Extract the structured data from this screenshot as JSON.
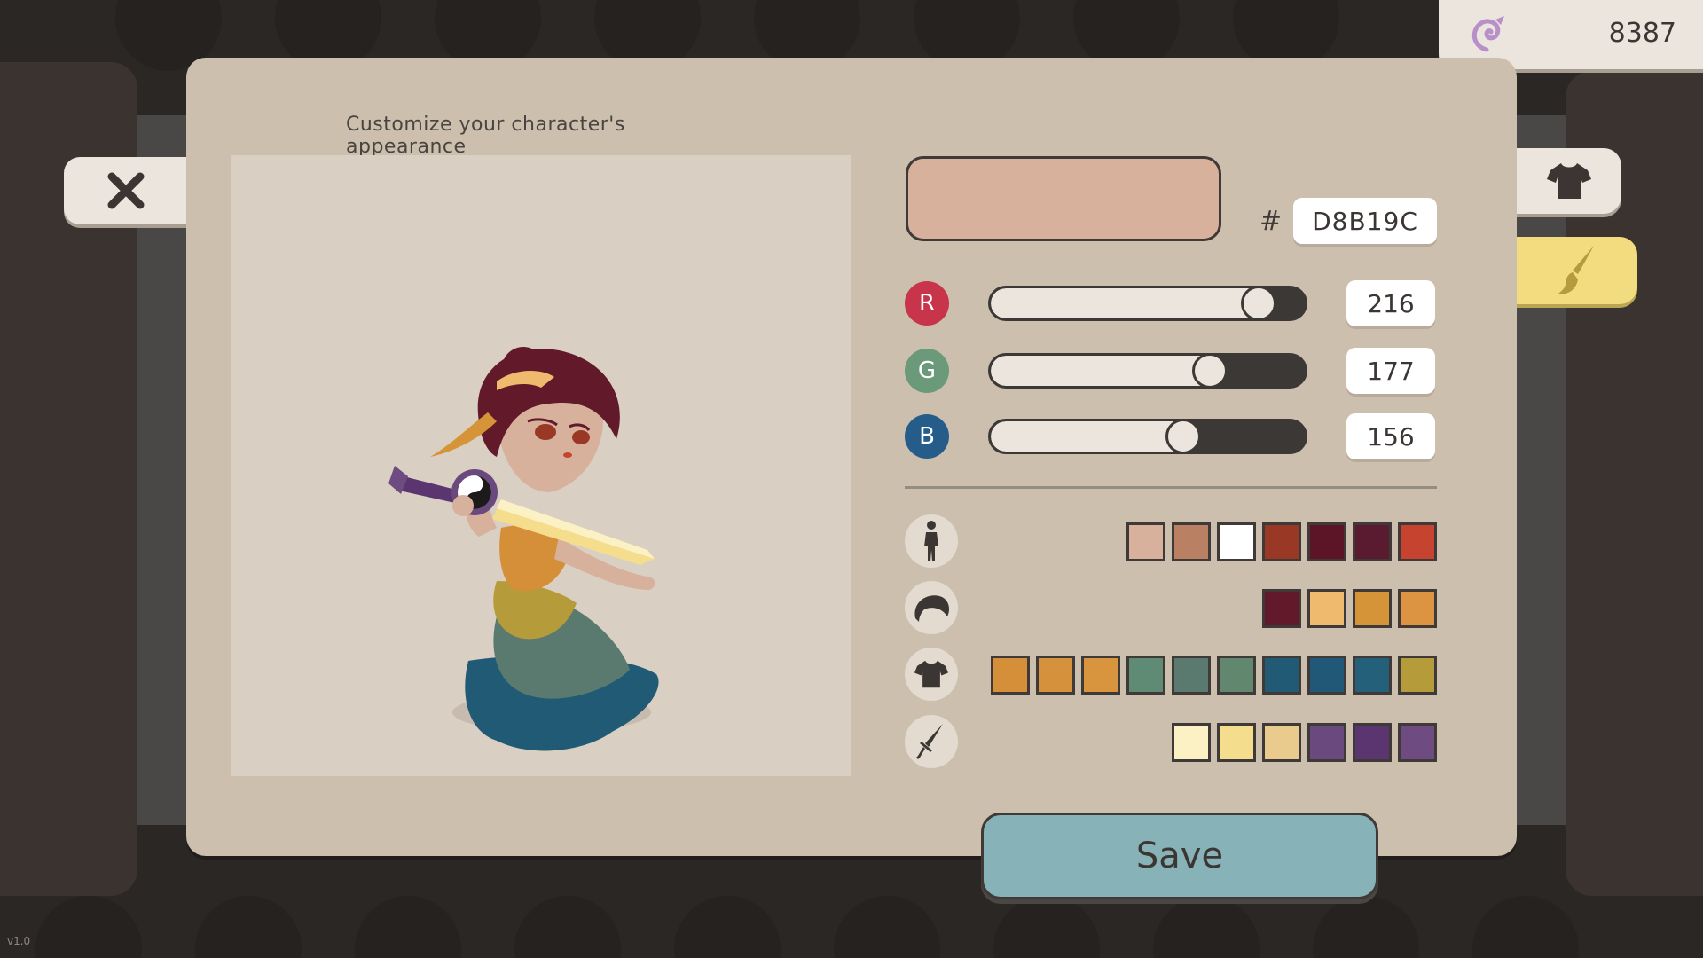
{
  "header": {
    "subtitle": "Customize your character's appearance"
  },
  "currency": {
    "icon": "swirl-coin-icon",
    "amount": "8387"
  },
  "tabs": [
    {
      "name": "outfit",
      "icon": "shirt-icon",
      "selected": false
    },
    {
      "name": "color",
      "icon": "paintbrush-icon",
      "selected": true
    }
  ],
  "color_editor": {
    "hash_symbol": "#",
    "hex": "D8B19C",
    "preview_color": "#D8B19C",
    "channels": [
      {
        "label": "R",
        "value": "216",
        "fraction": 0.847,
        "badge_color": "#c8344a"
      },
      {
        "label": "G",
        "value": "177",
        "fraction": 0.694,
        "badge_color": "#6a9a79"
      },
      {
        "label": "B",
        "value": "156",
        "fraction": 0.612,
        "badge_color": "#255c8a"
      }
    ]
  },
  "palettes": [
    {
      "part": "body",
      "icon": "person-icon",
      "colors": [
        "#d8b19c",
        "#b98064",
        "#ffffff",
        "#9a3826",
        "#5c1527",
        "#5a1a30",
        "#c5432f"
      ]
    },
    {
      "part": "hair",
      "icon": "hair-icon",
      "colors": [
        "#621a2a",
        "#efb96e",
        "#d69439",
        "#dc9342"
      ]
    },
    {
      "part": "outfit",
      "icon": "shirt-icon",
      "colors": [
        "#d68f39",
        "#d6913c",
        "#d9953d",
        "#5f8a74",
        "#5a7a70",
        "#61886f",
        "#215a74",
        "#215878",
        "#24607a",
        "#b69b3a"
      ]
    },
    {
      "part": "weapon",
      "icon": "sword-icon",
      "colors": [
        "#fbf1c5",
        "#f4dd8d",
        "#e9cb8d",
        "#6a4a7e",
        "#5a356f",
        "#6e4c82"
      ]
    }
  ],
  "buttons": {
    "save_label": "Save"
  },
  "version": "v1.0",
  "colors": {
    "panel": "#ccbfae",
    "preview_bg": "#d9cfc2",
    "save": "#87b2b8",
    "tab_active": "#f2dc7f"
  }
}
